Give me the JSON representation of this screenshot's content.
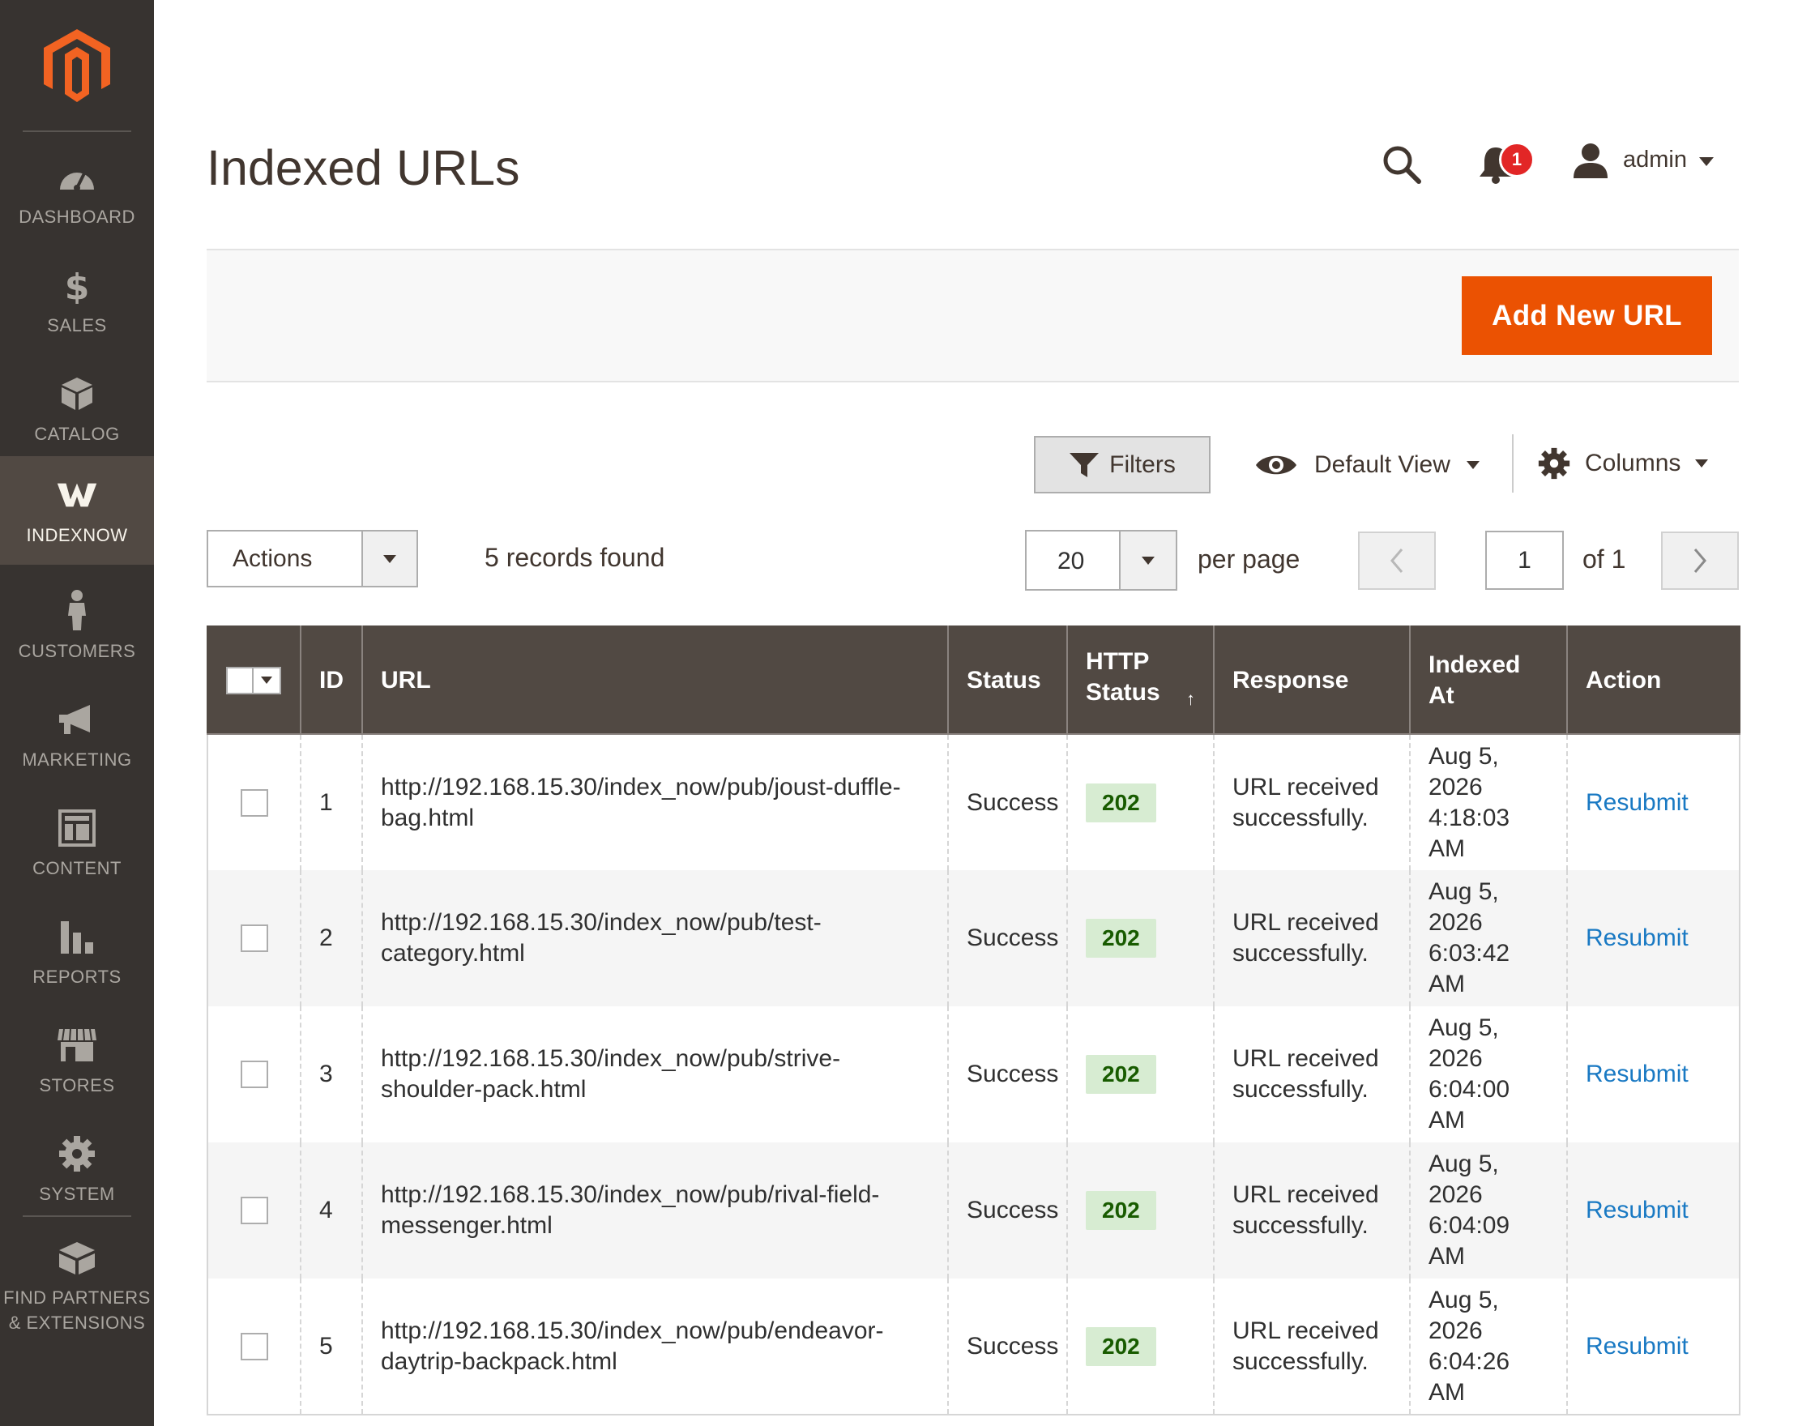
{
  "sidebar": {
    "items": [
      {
        "label": "DASHBOARD",
        "icon": "dashboard-icon",
        "active": false
      },
      {
        "label": "SALES",
        "icon": "dollar-icon",
        "active": false
      },
      {
        "label": "CATALOG",
        "icon": "box-icon",
        "active": false
      },
      {
        "label": "INDEXNOW",
        "icon": "indexnow-icon",
        "active": true
      },
      {
        "label": "CUSTOMERS",
        "icon": "person-icon",
        "active": false
      },
      {
        "label": "MARKETING",
        "icon": "megaphone-icon",
        "active": false
      },
      {
        "label": "CONTENT",
        "icon": "layout-icon",
        "active": false
      },
      {
        "label": "REPORTS",
        "icon": "bar-chart-icon",
        "active": false
      },
      {
        "label": "STORES",
        "icon": "store-icon",
        "active": false
      },
      {
        "label": "SYSTEM",
        "icon": "gear-icon",
        "active": false
      },
      {
        "label": "FIND PARTNERS\n& EXTENSIONS",
        "icon": "blocks-icon",
        "active": false
      }
    ]
  },
  "header": {
    "title": "Indexed URLs",
    "notifications_count": "1",
    "user_name": "admin"
  },
  "action_bar": {
    "add_button": "Add New URL"
  },
  "toolbar": {
    "filters_label": "Filters",
    "view_label": "Default View",
    "columns_label": "Columns",
    "actions_label": "Actions",
    "records_found": "5 records found",
    "per_page_value": "20",
    "per_page_label": "per page",
    "page_value": "1",
    "page_of": "of 1"
  },
  "grid": {
    "columns": [
      "ID",
      "URL",
      "Status",
      "HTTP Status",
      "Response",
      "Indexed At",
      "Action"
    ],
    "rows": [
      {
        "id": "1",
        "url": "http://192.168.15.30/index_now/pub/joust-duffle-bag.html",
        "status": "Success",
        "http": "202",
        "response": "URL received successfully.",
        "indexed_at": "Aug 5, 2026 4:18:03 AM",
        "action": "Resubmit"
      },
      {
        "id": "2",
        "url": "http://192.168.15.30/index_now/pub/test-category.html",
        "status": "Success",
        "http": "202",
        "response": "URL received successfully.",
        "indexed_at": "Aug 5, 2026 6:03:42 AM",
        "action": "Resubmit"
      },
      {
        "id": "3",
        "url": "http://192.168.15.30/index_now/pub/strive-shoulder-pack.html",
        "status": "Success",
        "http": "202",
        "response": "URL received successfully.",
        "indexed_at": "Aug 5, 2026 6:04:00 AM",
        "action": "Resubmit"
      },
      {
        "id": "4",
        "url": "http://192.168.15.30/index_now/pub/rival-field-messenger.html",
        "status": "Success",
        "http": "202",
        "response": "URL received successfully.",
        "indexed_at": "Aug 5, 2026 6:04:09 AM",
        "action": "Resubmit"
      },
      {
        "id": "5",
        "url": "http://192.168.15.30/index_now/pub/endeavor-daytrip-backpack.html",
        "status": "Success",
        "http": "202",
        "response": "URL received successfully.",
        "indexed_at": "Aug 5, 2026 6:04:26 AM",
        "action": "Resubmit"
      }
    ]
  },
  "colors": {
    "sidebar_bg": "#373330",
    "sidebar_active": "#514943",
    "accent": "#eb5202",
    "grid_header": "#514943",
    "link": "#1979c3",
    "badge_bg": "#d7ecd2",
    "badge_text": "#185b00"
  }
}
